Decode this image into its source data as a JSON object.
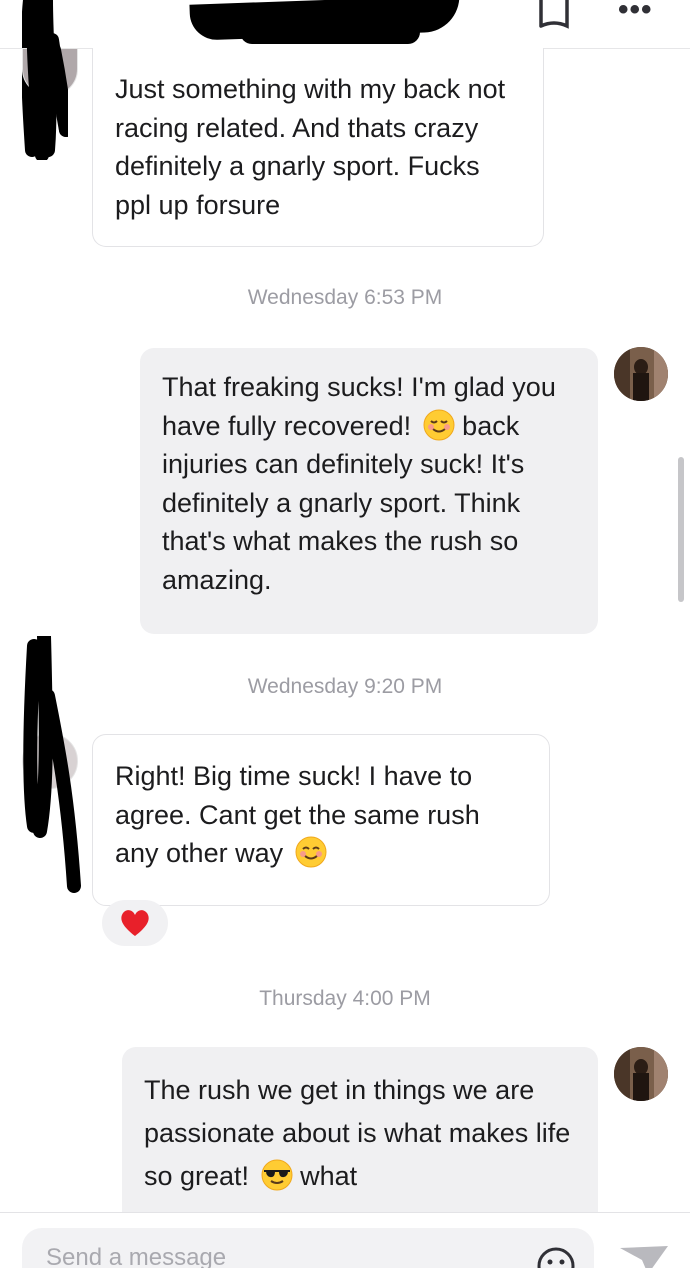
{
  "header": {
    "flag_icon": "flag-icon",
    "more_icon": "more-icon",
    "more_text": "•••"
  },
  "messages": [
    {
      "direction": "incoming",
      "text": "Just something with my back not racing related. And thats crazy definitely a gnarly sport. Fucks ppl up forsure"
    },
    {
      "direction": "outgoing",
      "text_before_emoji": "That freaking sucks! I'm glad you have fully recovered!",
      "emoji": "relieved-face-emoji",
      "text_after_emoji": "back injuries can definitely suck! It's definitely a gnarly sport. Think that's what makes the rush so amazing."
    },
    {
      "direction": "incoming",
      "text": "Right! Big time suck! I have to agree. Cant get the same rush any other way",
      "emoji": "smiling-face-emoji",
      "reaction": "heart-emoji"
    },
    {
      "direction": "outgoing",
      "text_before_emoji": "The rush we get in things we are passionate about is what makes life so great!",
      "emoji": "sunglasses-emoji",
      "text_after_emoji": "what"
    }
  ],
  "timestamps": [
    "Wednesday 6:53 PM",
    "Wednesday 9:20 PM",
    "Thursday 4:00 PM"
  ],
  "composer": {
    "placeholder": "Send a message",
    "emoji_icon": "smiley-icon",
    "send_icon": "send-icon"
  },
  "colors": {
    "outgoing_bubble": "#f0f0f2",
    "incoming_border": "#e3e3e6",
    "timestamp": "#9c9ca3",
    "reaction_bg": "#f1f1f3",
    "heart": "#e8202a"
  }
}
